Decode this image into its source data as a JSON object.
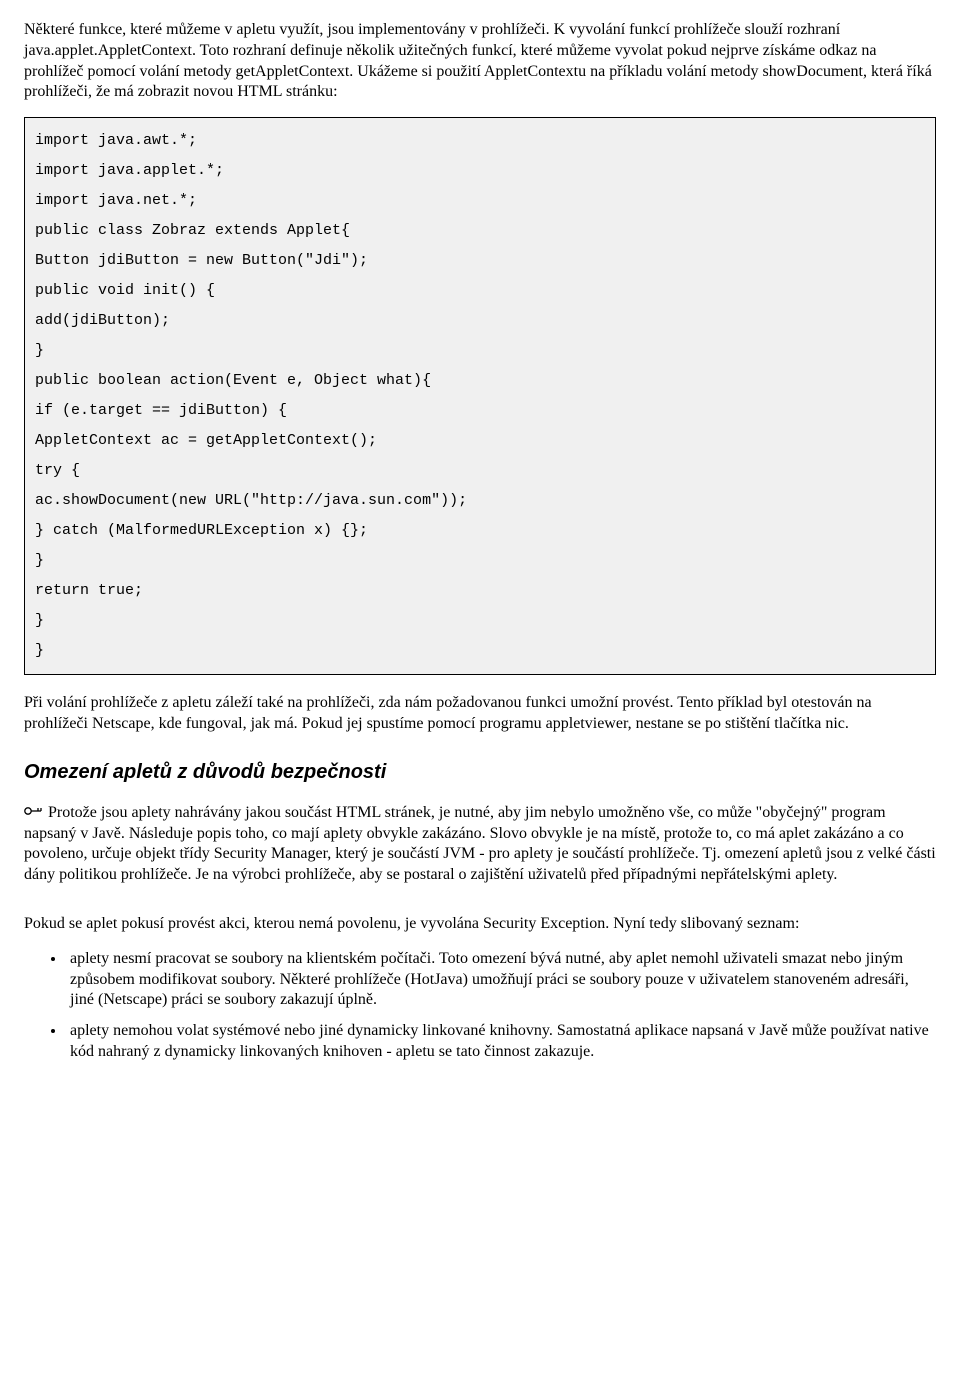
{
  "para1": "Některé funkce, které můžeme v apletu využít, jsou implementovány v prohlížeči. K vyvolání funkcí prohlížeče slouží rozhraní java.applet.AppletContext. Toto rozhraní definuje několik užitečných funkcí, které můžeme vyvolat pokud nejprve získáme odkaz na prohlížeč pomocí volání metody getAppletContext. Ukážeme si použití AppletContextu na příkladu volání metody showDocument, která říká prohlížeči, že má zobrazit novou HTML stránku:",
  "code": "import java.awt.*;\nimport java.applet.*;\nimport java.net.*;\npublic class Zobraz extends Applet{\nButton jdiButton = new Button(\"Jdi\");\npublic void init() {\nadd(jdiButton);\n}\npublic boolean action(Event e, Object what){\nif (e.target == jdiButton) {\nAppletContext ac = getAppletContext();\ntry {\nac.showDocument(new URL(\"http://java.sun.com\"));\n} catch (MalformedURLException x) {};\n}\nreturn true;\n}\n}",
  "para2": "Při volání prohlížeče z apletu záleží také na prohlížeči, zda nám požadovanou funkci umožní provést. Tento příklad byl otestován na prohlížeči Netscape, kde fungoval, jak má. Pokud jej spustíme pomocí programu appletviewer, nestane se po stištění tlačítka nic.",
  "heading": "Omezení apletů z důvodů bezpečnosti",
  "para3": " Protože jsou aplety nahrávány jakou součást HTML stránek, je nutné, aby jim nebylo umožněno vše, co může \"obyčejný\" program napsaný v Javě. Následuje popis toho, co mají aplety obvykle zakázáno. Slovo obvykle je na místě, protože to, co má aplet zakázáno a co povoleno, určuje objekt třídy Security Manager, který je součástí JVM - pro aplety je součástí prohlížeče. Tj. omezení apletů jsou z velké části dány politikou prohlížeče. Je na výrobci prohlížeče, aby se postaral o zajištění uživatelů před případnými nepřátelskými aplety.",
  "para4": "Pokud se aplet pokusí provést akci, kterou nemá povolenu, je vyvolána Security Exception. Nyní tedy slibovaný seznam:",
  "bullets": [
    "aplety nesmí pracovat se soubory na klientském počítači. Toto omezení bývá nutné, aby aplet nemohl uživateli smazat nebo jiným způsobem modifikovat soubory. Některé prohlížeče (HotJava) umožňují práci se soubory pouze v uživatelem stanoveném adresáři, jiné (Netscape) práci se soubory zakazují úplně.",
    "aplety nemohou volat systémové nebo jiné dynamicky linkované knihovny. Samostatná aplikace napsaná v Javě může používat native kód nahraný z dynamicky linkovaných knihoven - apletu se tato činnost zakazuje."
  ]
}
